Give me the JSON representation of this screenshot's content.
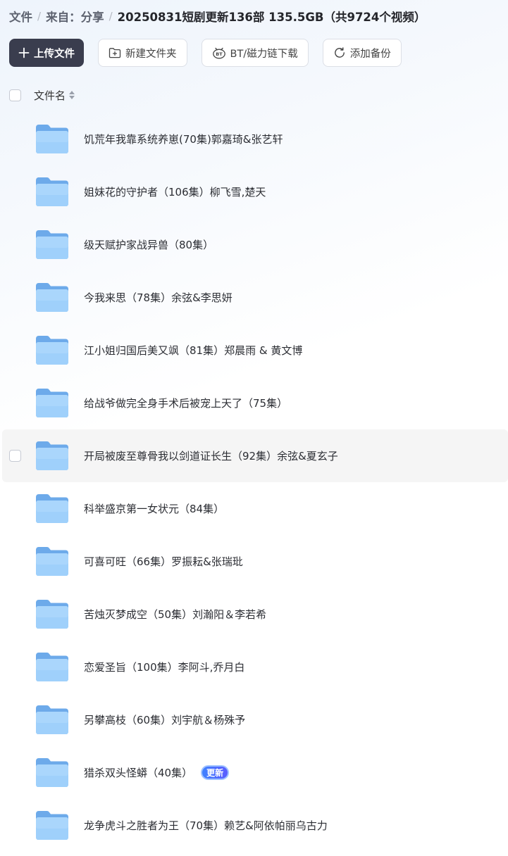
{
  "breadcrumb": {
    "root": "文件",
    "source": "来自：分享",
    "current": "20250831短剧更新136部 135.5GB（共9724个视频）",
    "separator": "/"
  },
  "toolbar": {
    "upload": "上传文件",
    "new_folder": "新建文件夹",
    "bt_download": "BT/磁力链下载",
    "add_backup": "添加备份"
  },
  "list_header": {
    "name_column": "文件名"
  },
  "files": [
    {
      "name": "饥荒年我靠系统养崽(70集)郭嘉琦&张艺轩",
      "badge": ""
    },
    {
      "name": "姐妹花的守护者（106集）柳飞雪,楚天",
      "badge": ""
    },
    {
      "name": "级天赋护家战异兽（80集）",
      "badge": ""
    },
    {
      "name": "今我来思（78集）余弦&李思妍",
      "badge": ""
    },
    {
      "name": "江小姐归国后美又飒（81集）郑晨雨 & 黄文博",
      "badge": ""
    },
    {
      "name": "给战爷做完全身手术后被宠上天了（75集）",
      "badge": ""
    },
    {
      "name": "开局被废至尊骨我以剑道证长生（92集）余弦&夏玄子",
      "badge": ""
    },
    {
      "name": "科举盛京第一女状元（84集）",
      "badge": ""
    },
    {
      "name": "可喜可旺（66集）罗振耘&张瑞玭",
      "badge": ""
    },
    {
      "name": "苦烛灭梦成空（50集）刘瀚阳＆李若希",
      "badge": ""
    },
    {
      "name": "恋爱圣旨（100集）李阿斗,乔月白",
      "badge": ""
    },
    {
      "name": "另攀高枝（60集）刘宇航＆杨殊予",
      "badge": ""
    },
    {
      "name": "猎杀双头怪蟒（40集）",
      "badge": "更新"
    },
    {
      "name": "龙争虎斗之胜者为王（70集）赖艺&阿依帕丽乌古力",
      "badge": ""
    }
  ],
  "hovered_row_index": 6,
  "colors": {
    "primary_button": "#3a3d4e",
    "folder": "#8fc3f5",
    "badge": "#4a73ff",
    "hover_row": "#f5f5f5"
  }
}
